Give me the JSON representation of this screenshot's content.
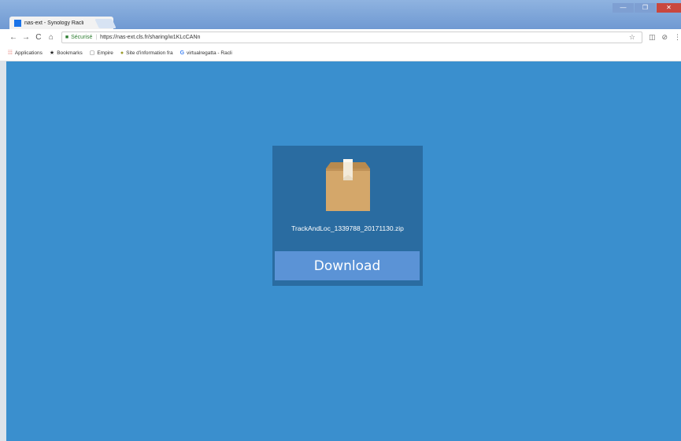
{
  "browser": {
    "tab_title": "nas-ext - Synology Racli",
    "tab_close": "×",
    "window_buttons": [
      "—",
      "❐",
      "✕"
    ],
    "nav": {
      "back": "←",
      "forward": "→",
      "reload": "C",
      "home": "⌂"
    },
    "address": {
      "security_label": "Sécurisé",
      "url": "https://nas-ext.cls.fr/sharing/w1KLcCANn"
    },
    "toolbar_icons": {
      "bookmark_star": "☆",
      "cast": "◫",
      "extension": "⊘",
      "menu": "⋮"
    }
  },
  "bookmarks_bar": {
    "items": [
      {
        "label": "Applications",
        "icon": "apps-icon",
        "glyph": "⁞⁞⁞"
      },
      {
        "label": "Bookmarks",
        "icon": "star-icon",
        "glyph": "★"
      },
      {
        "label": "Empire",
        "icon": "document-icon",
        "glyph": "▢"
      },
      {
        "label": "Site d'information fra",
        "icon": "site-icon",
        "glyph": "●"
      },
      {
        "label": "virtualregatta - Racli",
        "icon": "google-icon",
        "glyph": "G"
      }
    ]
  },
  "page": {
    "background_color": "#3a8fce",
    "card": {
      "file_icon": "package-box-icon",
      "filename": "TrackAndLoc_1339788_20171130.zip",
      "download_label": "Download"
    }
  }
}
